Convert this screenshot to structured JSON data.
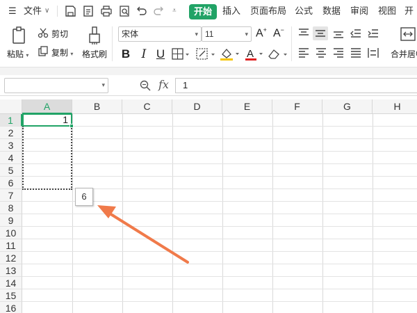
{
  "menubar": {
    "file_label": "文件",
    "tabs": [
      "开始",
      "插入",
      "页面布局",
      "公式",
      "数据",
      "审阅",
      "视图",
      "开发"
    ],
    "active_tab_color": "#21a366"
  },
  "ribbon": {
    "paste_label": "粘贴",
    "cut_label": "剪切",
    "copy_label": "复制",
    "format_painter_label": "格式刷",
    "font_name": "宋体",
    "font_size": "11",
    "merge_label": "合并居中"
  },
  "formula_bar": {
    "name_box_value": "",
    "fx_label": "fx",
    "formula_value": "1"
  },
  "sheet": {
    "columns": [
      "A",
      "B",
      "C",
      "D",
      "E",
      "F",
      "G",
      "H"
    ],
    "rows": [
      "1",
      "2",
      "3",
      "4",
      "5",
      "6",
      "7",
      "8",
      "9",
      "10",
      "11",
      "12",
      "13",
      "14",
      "15",
      "16"
    ],
    "active_cell_value": "1",
    "fill_tooltip_value": "6",
    "selection_color": "#21a366"
  },
  "annotation": {
    "arrow_color": "#f07a4a"
  }
}
